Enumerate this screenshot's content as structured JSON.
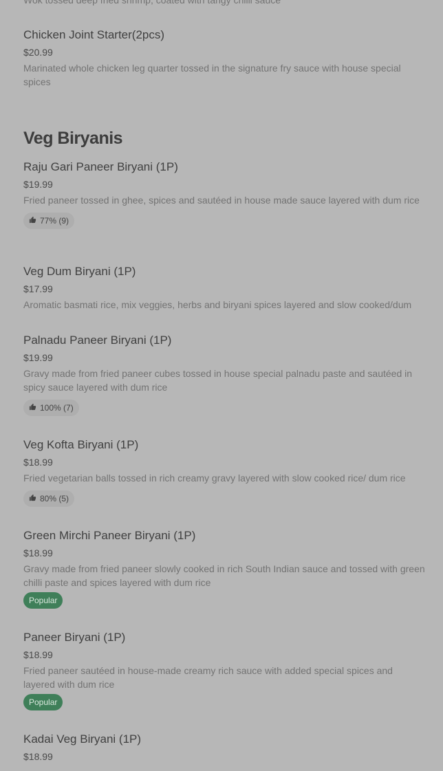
{
  "top_fragment": {
    "text": "Wok tossed deep fried shrimp, coated with tangy chilli sauce"
  },
  "starter_item": {
    "name": "Chicken Joint Starter(2pcs)",
    "price": "$20.99",
    "description": "Marinated whole chicken leg quarter tossed in the signature fry sauce with house special spices"
  },
  "section": {
    "title": "Veg Biryanis"
  },
  "items": [
    {
      "name": "Raju Gari Paneer Biryani (1P)",
      "price": "$19.99",
      "description": "Fried paneer tossed in ghee, spices and sautéed in house made sauce layered with dum rice",
      "rating": "77% (9)"
    },
    {
      "name": "Veg Dum Biryani (1P)",
      "price": "$17.99",
      "description": "Aromatic basmati rice, mix veggies, herbs and biryani spices layered and slow cooked/dum"
    },
    {
      "name": "Palnadu Paneer Biryani (1P)",
      "price": "$19.99",
      "description": "Gravy made from fried paneer cubes tossed in house special palnadu paste and sautéed in spicy sauce layered with dum rice",
      "rating": "100% (7)"
    },
    {
      "name": "Veg Kofta Biryani (1P)",
      "price": "$18.99",
      "description": "Fried vegetarian balls tossed in rich creamy gravy layered with slow cooked rice/ dum rice",
      "rating": "80% (5)"
    },
    {
      "name": "Green Mirchi Paneer Biryani (1P)",
      "price": "$18.99",
      "description": "Gravy made from fried paneer slowly cooked in rich South Indian sauce and tossed with green chilli paste and spices layered with dum rice",
      "badge": "Popular"
    },
    {
      "name": "Paneer Biryani (1P)",
      "price": "$18.99",
      "description": "Fried paneer sautéed in house-made creamy rich sauce with added special spices and layered with dum rice",
      "badge": "Popular"
    },
    {
      "name": "Kadai Veg Biryani (1P)",
      "price": "$18.99"
    }
  ],
  "colors": {
    "background": "#b7b7b7",
    "popular_badge": "#3f7f59",
    "rating_badge": "#aeaeae"
  },
  "icons": {
    "rating": "thumbs-up-icon"
  }
}
